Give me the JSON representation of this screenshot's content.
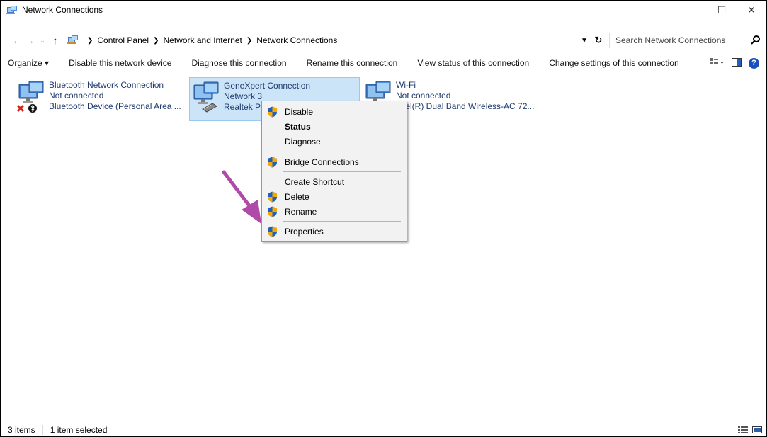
{
  "window": {
    "title": "Network Connections",
    "controls": {
      "minimize": "—",
      "maximize": "☐",
      "close": "✕"
    }
  },
  "address": {
    "crumbs": [
      "Control Panel",
      "Network and Internet",
      "Network Connections"
    ],
    "search_placeholder": "Search Network Connections"
  },
  "commands": [
    "Organize ▾",
    "Disable this network device",
    "Diagnose this connection",
    "Rename this connection",
    "View status of this connection",
    "Change settings of this connection"
  ],
  "connections": [
    {
      "name": "Bluetooth Network Connection",
      "status": "Not connected",
      "device": "Bluetooth Device (Personal Area ..."
    },
    {
      "name": "GeneXpert Connection",
      "status": "Network  3",
      "device": "Realtek P",
      "selected": true
    },
    {
      "name": "Wi-Fi",
      "status": "Not connected",
      "device": "Intel(R) Dual Band Wireless-AC 72..."
    }
  ],
  "context_menu": {
    "items": [
      {
        "label": "Disable",
        "shield": true
      },
      {
        "label": "Status",
        "bold": true
      },
      {
        "label": "Diagnose"
      },
      {
        "label": "Bridge Connections",
        "shield": true
      },
      {
        "label": "Create Shortcut"
      },
      {
        "label": "Delete",
        "shield": true
      },
      {
        "label": "Rename",
        "shield": true
      },
      {
        "label": "Properties",
        "shield": true
      }
    ]
  },
  "statusbar": {
    "count": "3 items",
    "selected": "1 item selected"
  },
  "colors": {
    "selection": "#cce4f7",
    "arrow": "#b04aa8",
    "shield_blue": "#1d5fc4",
    "shield_orange": "#f5a800"
  }
}
